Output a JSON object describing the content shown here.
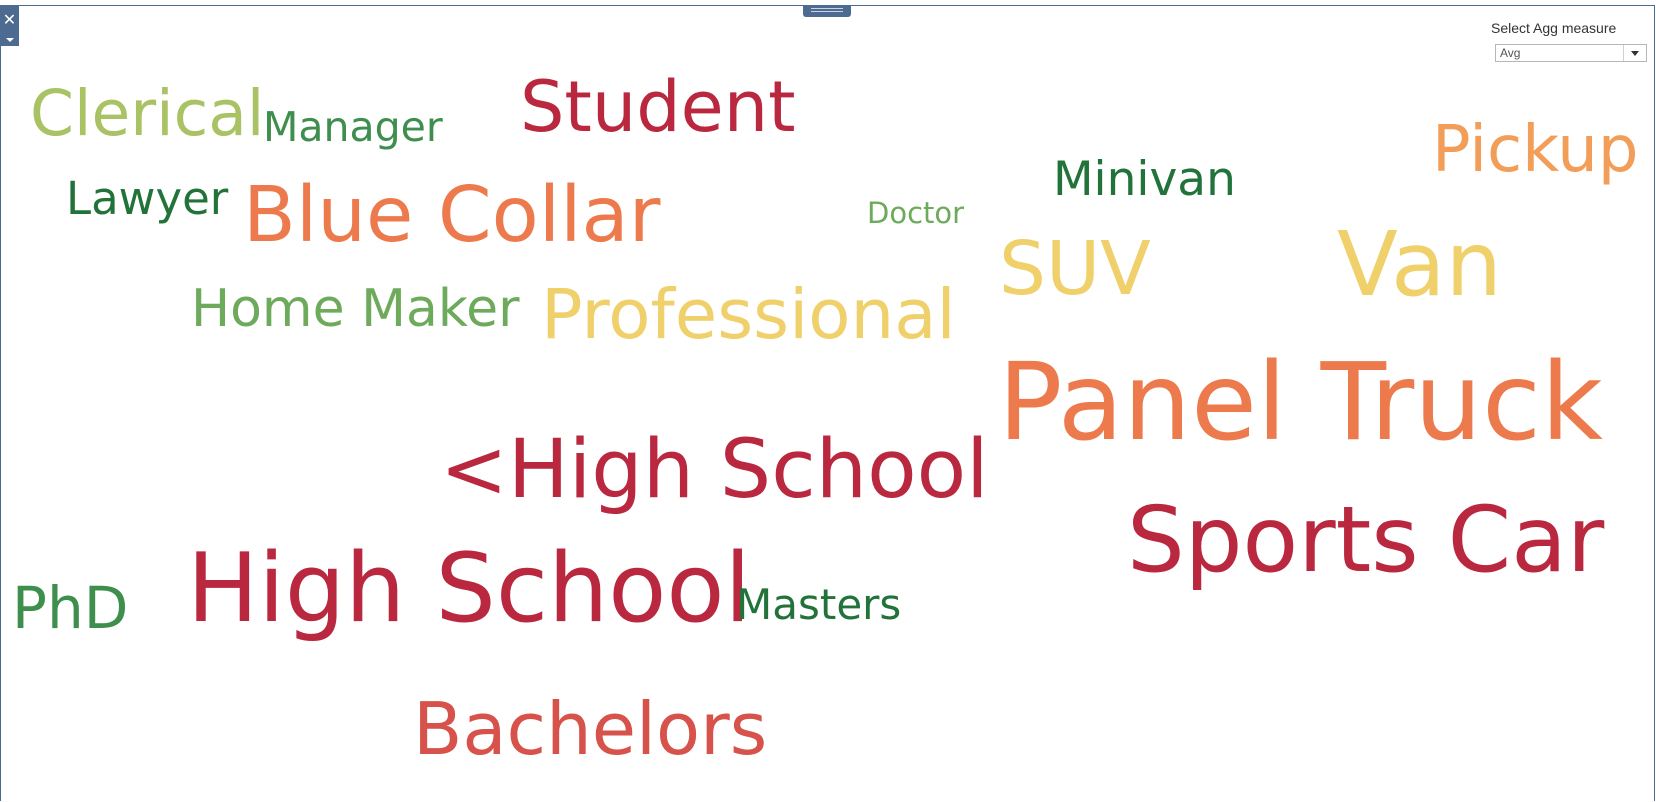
{
  "controls": {
    "close_glyph": "✕"
  },
  "filter": {
    "label": "Select Agg measure",
    "selected": "Avg"
  },
  "colors": {
    "frame": "#4d6a91",
    "dark_red": "#b9283f",
    "red": "#d6524a",
    "orange": "#ec7a4c",
    "light_orange": "#f29d58",
    "yellow": "#efd06a",
    "yellow_green": "#a9c263",
    "light_green": "#6daa5c",
    "green": "#3e8f4d",
    "dark_green": "#22733a"
  },
  "words": [
    {
      "text": "Clerical",
      "color": "#a9c263"
    },
    {
      "text": "Manager",
      "color": "#3e8f4d"
    },
    {
      "text": "Student",
      "color": "#b9283f"
    },
    {
      "text": "Lawyer",
      "color": "#22733a"
    },
    {
      "text": "Blue Collar",
      "color": "#ec7a4c"
    },
    {
      "text": "Doctor",
      "color": "#6daa5c"
    },
    {
      "text": "Minivan",
      "color": "#22733a"
    },
    {
      "text": "Pickup",
      "color": "#f29d58"
    },
    {
      "text": "SUV",
      "color": "#efd06a"
    },
    {
      "text": "Van",
      "color": "#efd06a"
    },
    {
      "text": "Home Maker",
      "color": "#6daa5c"
    },
    {
      "text": "Professional",
      "color": "#efd06a"
    },
    {
      "text": "Panel Truck",
      "color": "#ec7a4c"
    },
    {
      "text": "<High School",
      "color": "#b9283f"
    },
    {
      "text": "Sports Car",
      "color": "#b9283f"
    },
    {
      "text": "PhD",
      "color": "#3e8f4d"
    },
    {
      "text": "High School",
      "color": "#b9283f"
    },
    {
      "text": "Masters",
      "color": "#22733a"
    },
    {
      "text": "Bachelors",
      "color": "#d6524a"
    }
  ]
}
